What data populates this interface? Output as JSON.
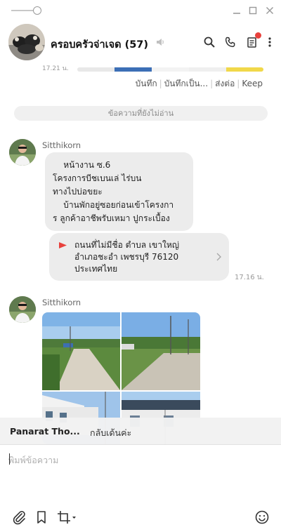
{
  "window": {
    "icons": [
      "slider-icon",
      "minimize-icon",
      "maximize-icon",
      "close-icon"
    ]
  },
  "header": {
    "title": "ครอบครัวจ่าเจด (57)",
    "icons": [
      "speaker-icon",
      "search-icon",
      "phone-icon",
      "notes-icon",
      "more-icon"
    ],
    "notification_color": "#e8413c"
  },
  "previous_message": {
    "time": "17.21 น."
  },
  "note_actions": {
    "save": "บันทึก",
    "save_as": "บันทึกเป็น...",
    "forward": "ส่งต่อ",
    "keep": "Keep"
  },
  "unread_divider": "ข้อความที่ยังไม่อ่าน",
  "messages": [
    {
      "sender": "Sitthikorn",
      "text_lines": [
        "    หน้างาน ซ.6",
        "โครงการบีชเบนเล่ ไร่บน",
        "ทางไปบ่อขยะ",
        "    บ้านพักอยู่ซอยก่อนเข้าโครงกา",
        "ร ลูกค้าอาชีพรับเหมา ปูกระเบื้อง"
      ]
    },
    {
      "type": "location",
      "address_lines": [
        "ถนนที่ไม่มีชื่อ ตำบล เขาใหญ่",
        "อำเภอชะอำ เพชรบุรี 76120",
        "ประเทศไทย"
      ],
      "time": "17.16 น."
    },
    {
      "sender": "Sitthikorn",
      "type": "photos",
      "photo_count": 4
    }
  ],
  "reply_preview": {
    "name": "Panarat Tho...",
    "text": "กลับเด้นค่ะ"
  },
  "composer": {
    "placeholder": "พิมพ์ข้อความ",
    "tools": [
      "attach-icon",
      "bookmark-icon",
      "crop-icon",
      "emoji-icon"
    ]
  }
}
